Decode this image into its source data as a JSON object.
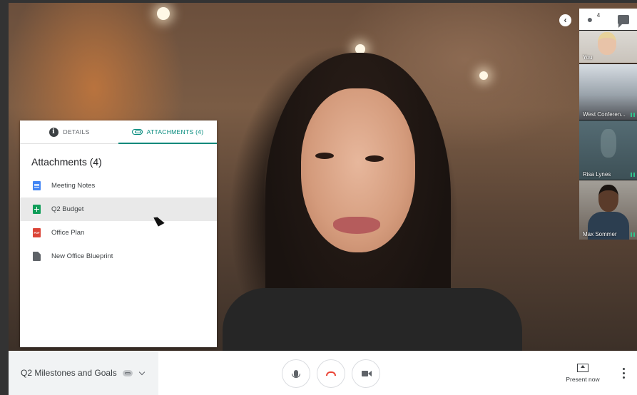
{
  "sidebar": {
    "participant_count": "4",
    "tiles": [
      {
        "name": "You"
      },
      {
        "name": "West Conferen..."
      },
      {
        "name": "Risa Lynes"
      },
      {
        "name": "Max Sommer"
      }
    ]
  },
  "attachments_panel": {
    "tab_details": "DETAILS",
    "tab_attachments": "ATTACHMENTS (4)",
    "title": "Attachments (4)",
    "items": [
      {
        "label": "Meeting Notes",
        "type": "doc"
      },
      {
        "label": "Q2 Budget",
        "type": "sheet"
      },
      {
        "label": "Office Plan",
        "type": "pdf",
        "badge": "PDF"
      },
      {
        "label": "New Office Blueprint",
        "type": "file"
      }
    ]
  },
  "bottom_bar": {
    "meeting_title": "Q2 Milestones and Goals",
    "present_label": "Present now"
  },
  "colors": {
    "accent": "#00897b",
    "hangup": "#ea4335",
    "doc": "#4285f4",
    "sheet": "#0f9d58",
    "pdf": "#db4437"
  }
}
